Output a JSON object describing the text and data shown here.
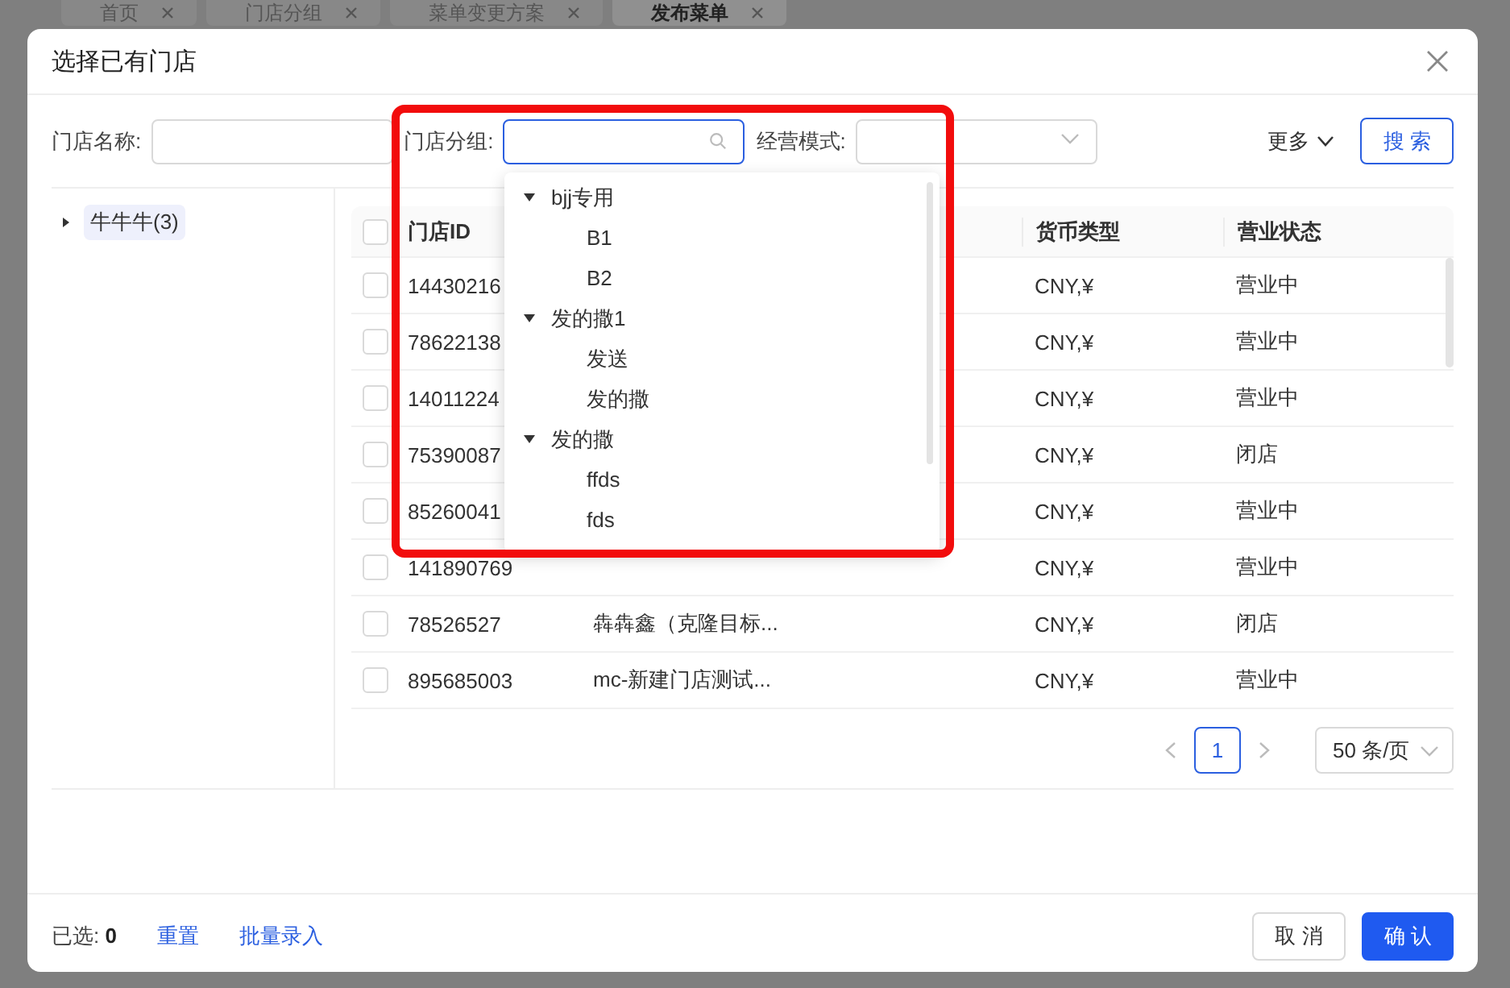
{
  "background_tabs": [
    {
      "label": "首页",
      "selected": false
    },
    {
      "label": "门店分组",
      "selected": false
    },
    {
      "label": "菜单变更方案",
      "selected": false
    },
    {
      "label": "发布菜单",
      "selected": true
    }
  ],
  "dialog": {
    "title": "选择已有门店"
  },
  "filters": [
    {
      "kind": "text",
      "label": "门店名称:",
      "focused": false
    },
    {
      "kind": "tree-select",
      "label": "门店分组:",
      "focused": true
    },
    {
      "kind": "select",
      "label": "经营模式:",
      "focused": false
    }
  ],
  "more": "更多",
  "search_button": "搜 索",
  "group_tree": [
    {
      "label": "牛牛牛(3)",
      "expanded": false,
      "selected": true
    }
  ],
  "table": {
    "columns": {
      "id": "门店ID",
      "currency": "货币类型",
      "status": "营业状态"
    },
    "header_checked": false,
    "rows": [
      {
        "id": "14430216",
        "currency": "CNY,¥",
        "status": "营业中",
        "checked": false
      },
      {
        "id": "78622138",
        "currency": "CNY,¥",
        "status": "营业中",
        "checked": false
      },
      {
        "id": "14011224",
        "currency": "CNY,¥",
        "status": "营业中",
        "checked": false
      },
      {
        "id": "75390087",
        "currency": "CNY,¥",
        "status": "闭店",
        "checked": false
      },
      {
        "id": "85260041",
        "currency": "CNY,¥",
        "status": "营业中",
        "checked": false
      },
      {
        "id": "141890769",
        "currency": "CNY,¥",
        "status": "营业中",
        "checked": false
      },
      {
        "id": "78526527",
        "name": "犇犇鑫（克隆目标...",
        "currency": "CNY,¥",
        "status": "闭店",
        "checked": false
      },
      {
        "id": "895685003",
        "name": "mc-新建门店测试...",
        "currency": "CNY,¥",
        "status": "营业中",
        "checked": false
      }
    ]
  },
  "pagination": {
    "page": "1",
    "page_size": "50 条/页"
  },
  "dropdown": {
    "items": [
      {
        "label": "bjj专用",
        "expanded": true,
        "children": [
          {
            "label": "B1"
          },
          {
            "label": "B2"
          }
        ]
      },
      {
        "label": "发的撒1",
        "expanded": true,
        "children": [
          {
            "label": "发送"
          },
          {
            "label": "发的撒"
          }
        ]
      },
      {
        "label": "发的撒",
        "expanded": true,
        "children": [
          {
            "label": "ffds"
          },
          {
            "label": "fds"
          }
        ]
      }
    ]
  },
  "footer": {
    "selected_label": "已选:",
    "selected_count": "0",
    "links": [
      "重置",
      "批量录入"
    ],
    "buttons": [
      {
        "label": "取 消",
        "kind": "default"
      },
      {
        "label": "确 认",
        "kind": "primary"
      }
    ]
  }
}
